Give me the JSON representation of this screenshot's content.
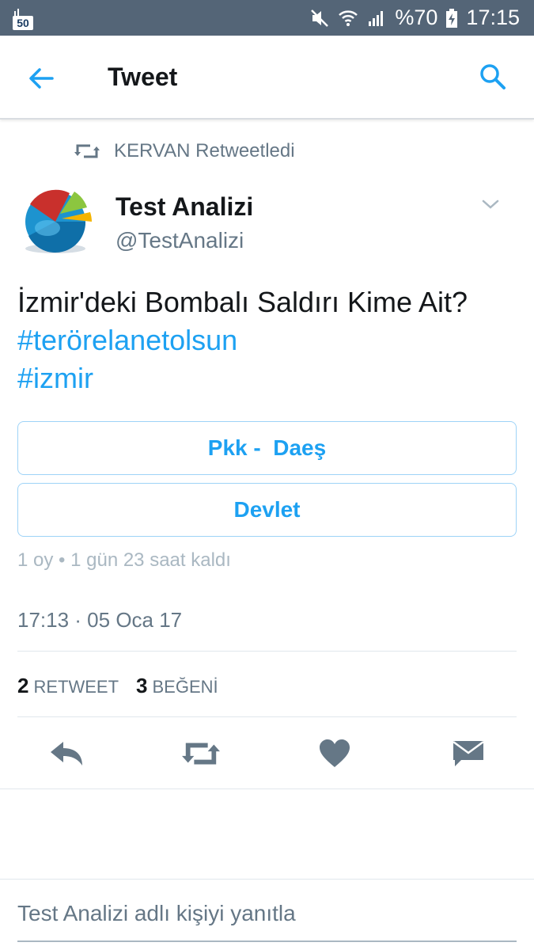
{
  "status_bar": {
    "badge": "50",
    "battery": "%70",
    "time": "17:15",
    "icons": [
      "mute-icon",
      "wifi-icon",
      "signal-icon",
      "battery-charging-icon"
    ]
  },
  "header": {
    "title": "Tweet",
    "back_icon": "back-arrow-icon",
    "search_icon": "search-icon"
  },
  "retweet_header": {
    "icon": "retweet-icon",
    "text": "KERVAN Retweetledi"
  },
  "author": {
    "name": "Test Analizi",
    "handle": "@TestAnalizi"
  },
  "tweet": {
    "text": "İzmir'deki Bombalı Saldırı Kime Ait?",
    "hashtags": [
      "#terörelanetolsun",
      "#izmir"
    ]
  },
  "poll": {
    "options": [
      "Pkk -  Daeş",
      "Devlet"
    ],
    "meta": "1 oy • 1 gün 23 saat kaldı"
  },
  "timestamp": "17:13 · 05 Oca 17",
  "stats": {
    "retweet_count": "2",
    "retweet_label": "RETWEET",
    "like_count": "3",
    "like_label": "BEĞENİ"
  },
  "actions": [
    "reply-icon",
    "retweet-icon",
    "heart-icon",
    "message-icon"
  ],
  "colors": {
    "accent": "#1da1f2",
    "status_bar": "#546577",
    "text_secondary": "#657786",
    "icon_gray": "#657786"
  },
  "reply": {
    "placeholder": "Test Analizi adlı kişiyi yanıtla"
  }
}
